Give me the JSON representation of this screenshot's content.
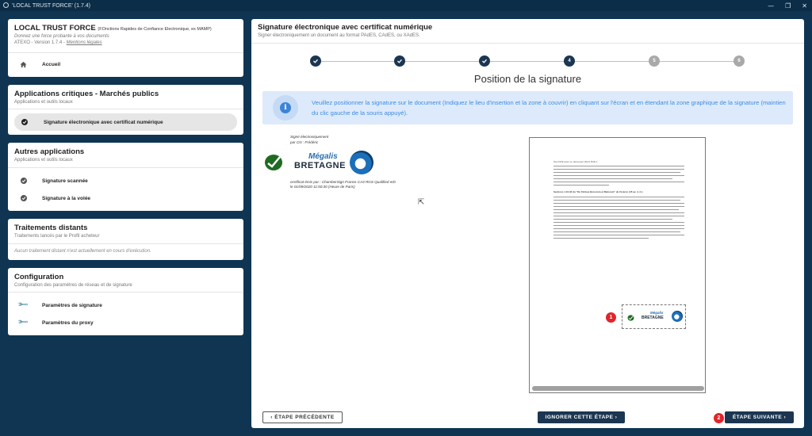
{
  "window": {
    "title": "'LOCAL TRUST FORCE' (1.7.4)",
    "controls": [
      "—",
      "❐",
      "✕"
    ]
  },
  "sidebar": {
    "app": {
      "name": "LOCAL TRUST FORCE",
      "name_suffix": "(FOnctions Rapides de Confiance Electronique, ex MAMP)",
      "tagline": "Donnez une force probante à vos documents",
      "version": "ATEXO - Version 1.7.4 -",
      "legal_link": "Mentions légales",
      "home": "Accueil"
    },
    "critical": {
      "title": "Applications critiques - Marchés publics",
      "subtitle": "Applications et outils locaux",
      "items": [
        {
          "label": "Signature électronique avec certificat numérique",
          "icon": "check-circle-icon"
        }
      ]
    },
    "other": {
      "title": "Autres applications",
      "subtitle": "Applications et outils locaux",
      "items": [
        {
          "label": "Signature scannée",
          "icon": "check-circle-icon"
        },
        {
          "label": "Signature à la volée",
          "icon": "check-circle-icon"
        }
      ]
    },
    "remote": {
      "title": "Traitements distants",
      "subtitle": "Traitements lancés par le Profil acheteur",
      "empty": "Aucun traitement distant n'est actuellement en cours d'exécution."
    },
    "config": {
      "title": "Configuration",
      "subtitle": "Configuration des paramètres de réseau et de signature",
      "items": [
        {
          "label": "Paramètres de signature",
          "icon": "wrench-icon"
        },
        {
          "label": "Paramètres du proxy",
          "icon": "wrench-icon"
        }
      ]
    }
  },
  "main": {
    "title": "Signature électronique avec certificat numérique",
    "subtitle": "Signer électroniquement un document au format PAdES, CAdES, ou XAdES.",
    "steps": [
      {
        "label": "",
        "state": "done"
      },
      {
        "label": "",
        "state": "done"
      },
      {
        "label": "",
        "state": "done"
      },
      {
        "label": "4",
        "state": "current"
      },
      {
        "label": "5",
        "state": "todo"
      },
      {
        "label": "6",
        "state": "todo"
      }
    ],
    "step_title": "Position de la signature",
    "info": "Veuillez positionner la signature sur le document (Indiquez le lieu d'insertion et la zone à couvrir) en cliquant sur l'écran et en étendant la zone graphique de la signature (maintien du clic gauche de la souris appuyé).",
    "signature_preview": {
      "line1": "Signé électroniquement",
      "line2": "par CN : Frédéric",
      "line3": "certificat émis par : ChamberSign France CA3 RGS Qualified eID",
      "line4": "le 01/09/2020 11:50:30 (Heure de Paris)",
      "brand_top": "Mégalis",
      "brand_bottom": "BRETAGNE"
    },
    "document": {
      "heading": "Test DCE avec un document Word DCE 1",
      "section": "Sections 1.10.32 du \"De Finibus Bonorum et Malorum\" de Cicéron (45 av. J.-C.)"
    },
    "badges": [
      "1",
      "2"
    ],
    "buttons": {
      "previous": "‹ ÉTAPE PRÉCÉDENTE",
      "skip": "IGNORER CETTE ÉTAPE ›",
      "next": "ÉTAPE SUIVANTE ›"
    }
  }
}
